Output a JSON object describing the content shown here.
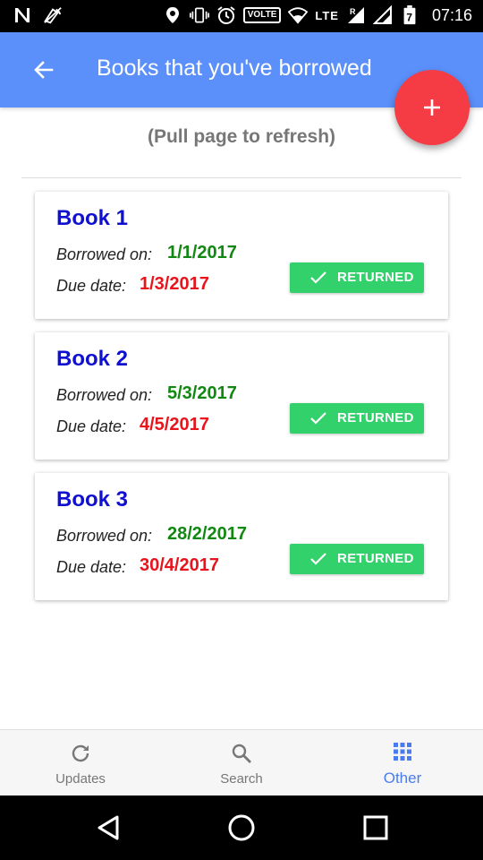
{
  "status_bar": {
    "left_icons": [
      "notification-n-icon",
      "no-signal-phone-icon"
    ],
    "right_icons": [
      "location-icon",
      "vibrate-icon",
      "alarm-icon",
      "volte-badge",
      "wifi-icon",
      "lte-signal-icon",
      "signal-icon",
      "battery-icon"
    ],
    "volte": "VOLTE",
    "lte": "LTE",
    "roaming": "R",
    "battery": "7",
    "time": "07:16"
  },
  "app_bar": {
    "title": "Books that you've borrowed",
    "back_icon": "arrow-back-icon",
    "color": "#5b8ff9"
  },
  "fab": {
    "icon": "plus-icon",
    "color": "#f53c45"
  },
  "refresh_hint": "(Pull page to refresh)",
  "books": [
    {
      "title": "Book 1",
      "borrowed_label": "Borrowed on:",
      "borrowed_on": "1/1/2017",
      "due_label": "Due date:",
      "due_date": "1/3/2017",
      "status": "RETURNED"
    },
    {
      "title": "Book 2",
      "borrowed_label": "Borrowed on:",
      "borrowed_on": "5/3/2017",
      "due_label": "Due date:",
      "due_date": "4/5/2017",
      "status": "RETURNED"
    },
    {
      "title": "Book 3",
      "borrowed_label": "Borrowed on:",
      "borrowed_on": "28/2/2017",
      "due_label": "Due date:",
      "due_date": "30/4/2017",
      "status": "RETURNED"
    }
  ],
  "bottom_nav": {
    "items": [
      {
        "label": "Updates",
        "icon": "refresh-icon",
        "active": false
      },
      {
        "label": "Search",
        "icon": "search-icon",
        "active": false
      },
      {
        "label": "Other",
        "icon": "grid-icon",
        "active": true
      }
    ]
  },
  "colors": {
    "title_blue": "#1010d0",
    "borrowed_green": "#118811",
    "due_red": "#e8141c",
    "returned_green": "#33d16c",
    "active_nav": "#4a7cf0"
  }
}
